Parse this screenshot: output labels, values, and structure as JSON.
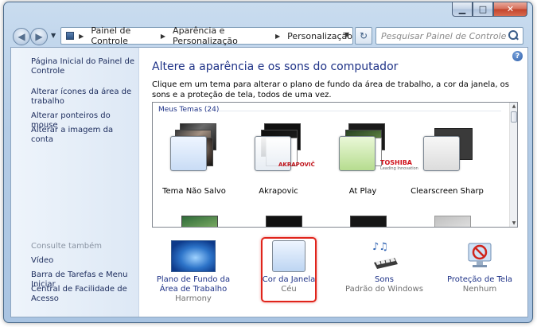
{
  "window": {
    "caption_buttons": {
      "minimize": "▁",
      "maximize": "□",
      "close": "✕"
    }
  },
  "nav": {
    "back_icon": "back-arrow-icon",
    "forward_icon": "forward-arrow-icon",
    "breadcrumbs": [
      "Painel de Controle",
      "Aparência e Personalização",
      "Personalização"
    ],
    "search_placeholder": "Pesquisar Painel de Controle"
  },
  "sidebar": {
    "links": [
      "Página Inicial do Painel de Controle",
      "Alterar ícones da área de trabalho",
      "Alterar ponteiros do mouse",
      "Alterar a imagem da conta"
    ],
    "see_also_heading": "Consulte também",
    "see_also": [
      "Vídeo",
      "Barra de Tarefas e Menu Iniciar",
      "Central de Facilidade de Acesso"
    ]
  },
  "main": {
    "title": "Altere a aparência e os sons do computador",
    "description": "Clique em um tema para alterar o plano de fundo da área de trabalho, a cor da janela, os sons e a proteção de tela, todos de uma vez.",
    "help_icon_text": "?",
    "group_label": "Meus Temas (24)",
    "themes": [
      {
        "name": "Tema Não Salvo",
        "brand": ""
      },
      {
        "name": "Akrapovic",
        "brand": "AKRAPOVIČ"
      },
      {
        "name": "At Play",
        "brand": "TOSHIBA"
      },
      {
        "name": "Clearscreen Sharp",
        "brand": ""
      }
    ],
    "toshiba_tagline": "Leading Innovation"
  },
  "settings": [
    {
      "title": "Plano de Fundo da Área de Trabalho",
      "value": "Harmony",
      "icon": "desktop-background-icon"
    },
    {
      "title": "Cor da Janela",
      "value": "Céu",
      "icon": "window-color-icon"
    },
    {
      "title": "Sons",
      "value": "Padrão do Windows",
      "icon": "sounds-icon"
    },
    {
      "title": "Proteção de Tela",
      "value": "Nenhum",
      "icon": "screensaver-icon"
    }
  ],
  "colors": {
    "link": "#1e3287",
    "title": "#1e3287",
    "highlight": "#e0241b"
  }
}
